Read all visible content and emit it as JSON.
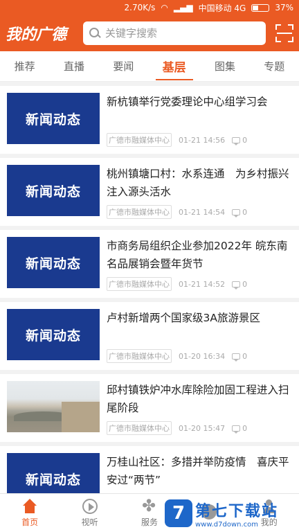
{
  "status_bar": {
    "speed": "2.70K/s",
    "carrier": "中国移动 4G",
    "battery": "37%"
  },
  "header": {
    "title": "我的广德",
    "search_placeholder": "关键字搜索"
  },
  "tabs": [
    {
      "label": "推荐",
      "active": false
    },
    {
      "label": "直播",
      "active": false
    },
    {
      "label": "要闻",
      "active": false
    },
    {
      "label": "基层",
      "active": true
    },
    {
      "label": "图集",
      "active": false
    },
    {
      "label": "专题",
      "active": false
    }
  ],
  "news": [
    {
      "thumb_text": "新闻动态",
      "title": "新杭镇举行党委理论中心组学习会",
      "source": "广德市融媒体中心",
      "time": "01-21 14:56",
      "comments": "0"
    },
    {
      "thumb_text": "新闻动态",
      "title": "桃州镇塘口村：水系连通　为乡村振兴注入源头活水",
      "source": "广德市融媒体中心",
      "time": "01-21 14:54",
      "comments": "0"
    },
    {
      "thumb_text": "新闻动态",
      "title": "市商务局组织企业参加2022年 皖东南名品展销会暨年货节",
      "source": "广德市融媒体中心",
      "time": "01-21 14:52",
      "comments": "0"
    },
    {
      "thumb_text": "新闻动态",
      "title": "卢村新增两个国家级3A旅游景区",
      "source": "广德市融媒体中心",
      "time": "01-20 16:34",
      "comments": "0"
    },
    {
      "thumb_text": "",
      "title": "邱村镇铁炉冲水库除险加固工程进入扫尾阶段",
      "source": "广德市融媒体中心",
      "time": "01-20 15:47",
      "comments": "0"
    },
    {
      "thumb_text": "新闻动态",
      "title": "万桂山社区：多措并举防疫情　喜庆平安过“两节”",
      "source": "",
      "time": "",
      "comments": ""
    }
  ],
  "bottom_nav": {
    "home": "首页",
    "video": "视听",
    "service": "服务",
    "item4": "",
    "mine": "我的"
  },
  "watermark": {
    "logo": "7",
    "main": "第七下载站",
    "url": "www.d7down.com"
  }
}
